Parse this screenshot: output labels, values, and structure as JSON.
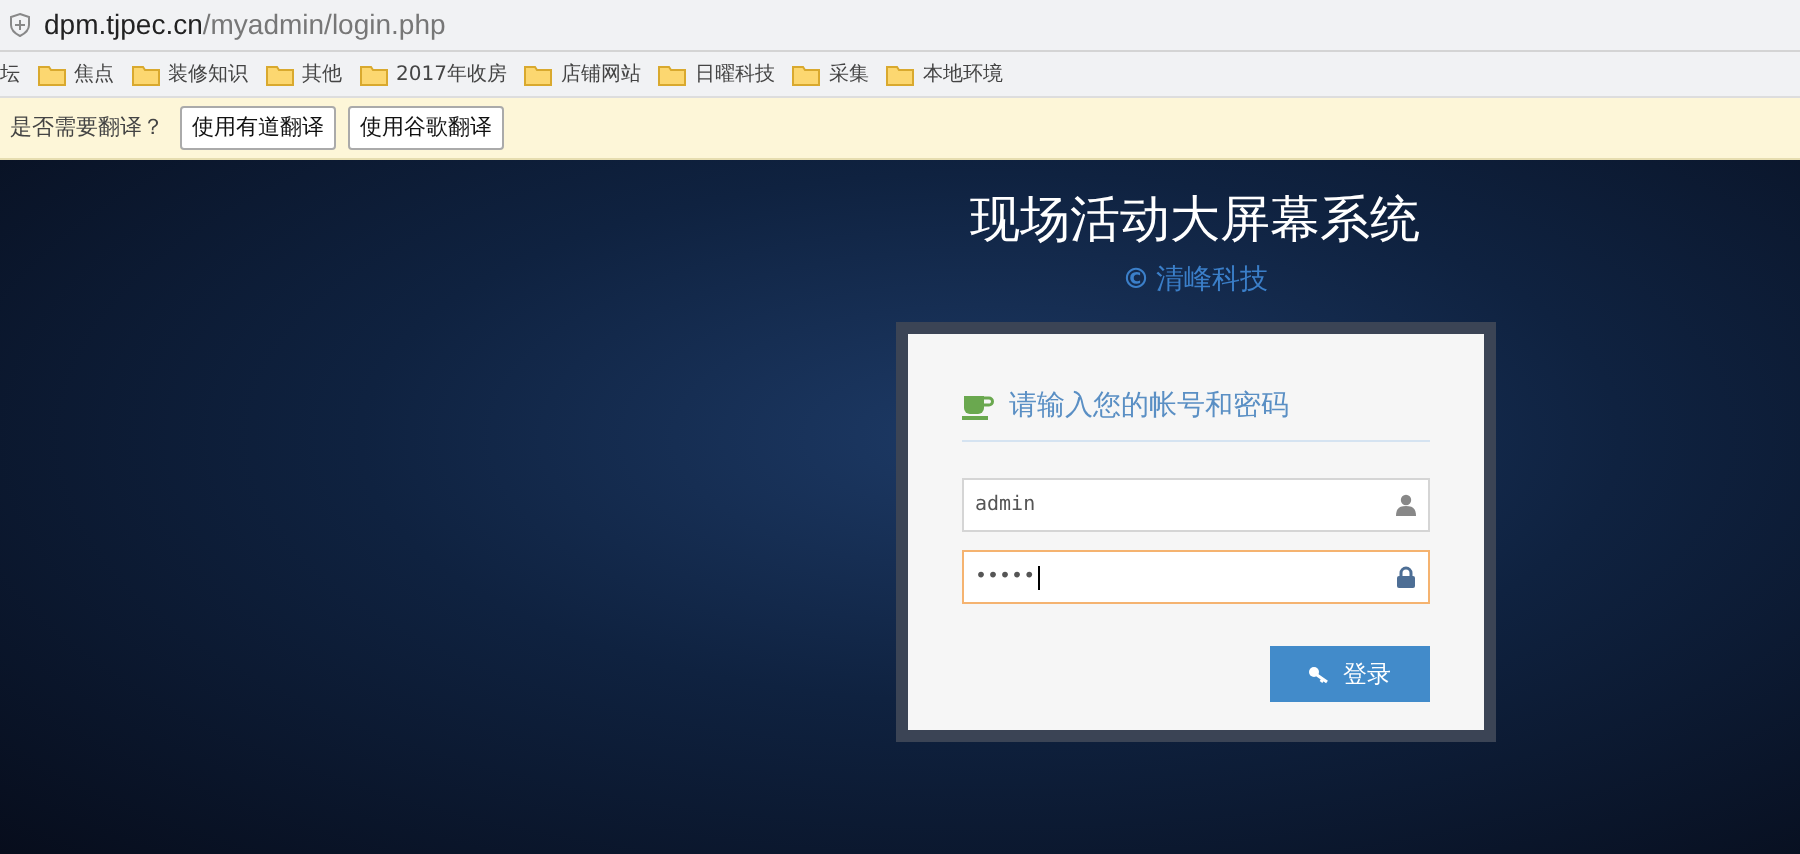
{
  "address_bar": {
    "domain": "dpm.tjpec.cn",
    "path": "/myadmin/login.php"
  },
  "bookmarks": [
    {
      "label": "坛",
      "kind": "text"
    },
    {
      "label": "焦点",
      "kind": "folder"
    },
    {
      "label": "装修知识",
      "kind": "folder"
    },
    {
      "label": "其他",
      "kind": "folder"
    },
    {
      "label": "2017年收房",
      "kind": "folder"
    },
    {
      "label": "店铺网站",
      "kind": "folder"
    },
    {
      "label": "日曜科技",
      "kind": "folder"
    },
    {
      "label": "采集",
      "kind": "folder"
    },
    {
      "label": "本地环境",
      "kind": "folder"
    }
  ],
  "translate_bar": {
    "prompt": "是否需要翻译？",
    "buttons": [
      "使用有道翻译",
      "使用谷歌翻译"
    ]
  },
  "page": {
    "title": "现场活动大屏幕系统",
    "copyright": "©",
    "company": "清峰科技"
  },
  "login": {
    "heading": "请输入您的帐号和密码",
    "fields": [
      {
        "kind": "user",
        "value": "admin",
        "focused": false
      },
      {
        "kind": "password",
        "value": "•••••",
        "focused": true
      }
    ],
    "submit": "登录"
  }
}
